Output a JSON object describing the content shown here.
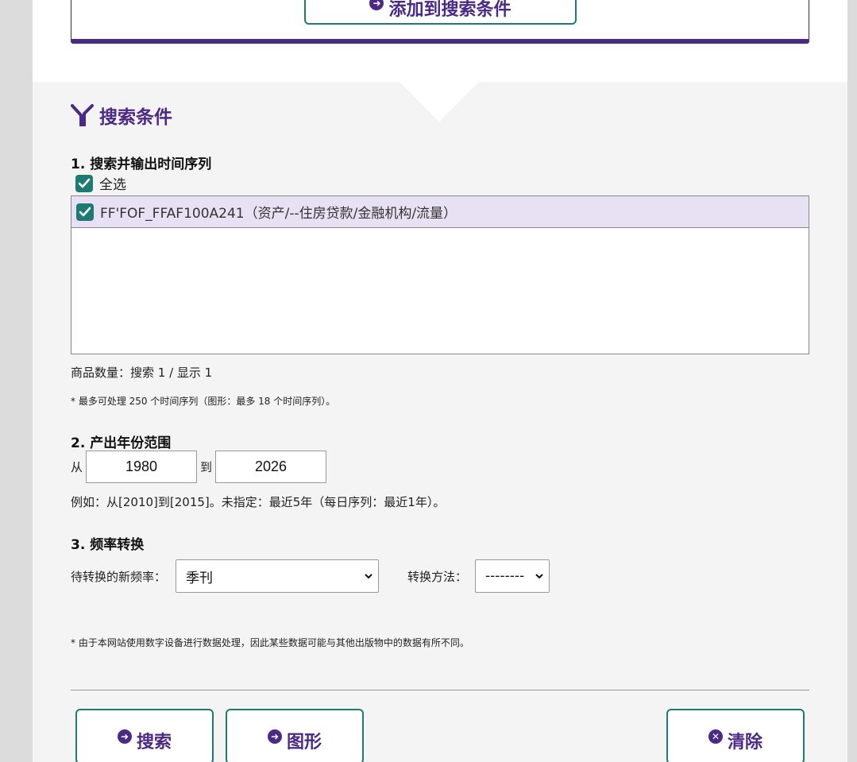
{
  "top": {
    "add_button_label": "添加到搜索条件"
  },
  "section": {
    "title": "搜索条件"
  },
  "step1": {
    "heading": "1. 搜索并输出时间序列",
    "select_all_label": "全选",
    "series": [
      {
        "label": "FF'FOF_FFAF100A241（资产/--住房贷款/金融机构/流量）",
        "checked": true
      }
    ],
    "count_text": "商品数量：搜索 1 / 显示 1",
    "note": "* 最多可处理 250 个时间序列（图形：最多 18 个时间序列）。"
  },
  "step2": {
    "heading": "2. 产出年份范围",
    "from_label": "从",
    "to_label": "到",
    "from_value": "1980",
    "to_value": "2026",
    "example": "例如：从[2010]到[2015]。未指定：最近5年（每日序列：最近1年）。"
  },
  "step3": {
    "heading": "3. 频率转换",
    "new_freq_label": "待转换的新频率：",
    "new_freq_value": "季刊",
    "method_label": "转换方法：",
    "method_value": "--------"
  },
  "disclaimer": "* 由于本网站使用数字设备进行数据处理，因此某些数据可能与其他出版物中的数据有所不同。",
  "buttons": {
    "search": "搜索",
    "graph": "图形",
    "clear": "清除"
  },
  "colors": {
    "accent": "#4b2a86",
    "button_border": "#1d7b74",
    "row_highlight": "#e8e0f3"
  },
  "icons": {
    "arrow": "arrow-circle-icon",
    "clear": "x-circle-icon",
    "filter": "filter-icon",
    "checkbox": "checkbox-checked-icon"
  }
}
